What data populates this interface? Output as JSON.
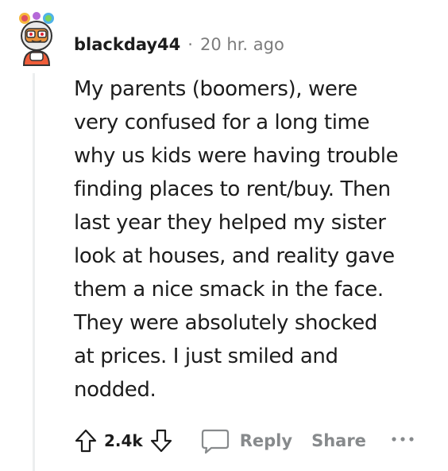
{
  "comment": {
    "author": "blackday44",
    "separator": "·",
    "timestamp": "20 hr. ago",
    "body_lines": [
      "My parents (boomers), were",
      "very confused for a long time",
      "why us kids were having trouble",
      "finding places to rent/buy. Then",
      "last year they helped my sister",
      "look at houses, and reality gave",
      "them a nice smack in the face.",
      "They were absolutely shocked",
      "at prices. I just smiled and",
      "nodded."
    ]
  },
  "actions": {
    "vote_count": "2.4k",
    "reply_label": "Reply",
    "share_label": "Share"
  },
  "icons": {
    "upvote": "arrow-up-icon",
    "downvote": "arrow-down-icon",
    "comment": "speech-bubble-icon",
    "more": "ellipsis-icon"
  },
  "colors": {
    "text": "#1c1c1c",
    "meta": "#7c7c7c",
    "action_gray": "#878a8c",
    "thread_line": "#eceeef"
  }
}
